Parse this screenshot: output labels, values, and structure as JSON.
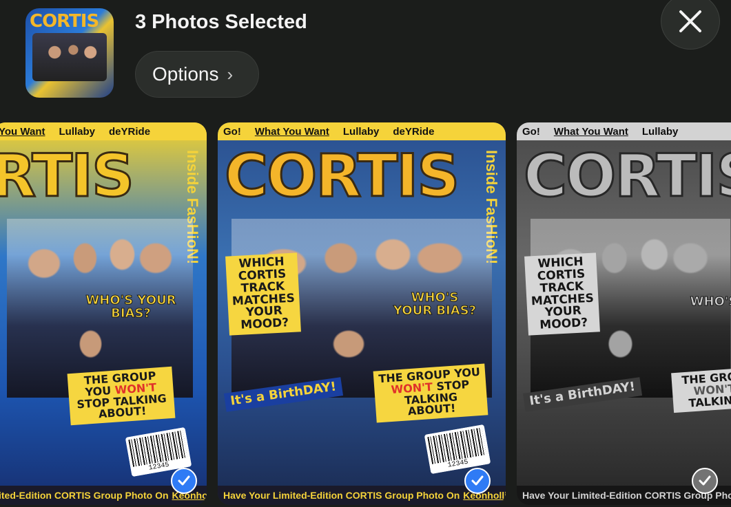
{
  "header": {
    "title": "3 Photos Selected",
    "options_label": "Options",
    "options_chevron": "›",
    "close_icon": "close-icon"
  },
  "thumbnail": {
    "title": "CORTIS"
  },
  "colors": {
    "accent": "#2f7bf5",
    "background": "#1b1d1b",
    "magazine_yellow": "#f5d33a",
    "magazine_orange": "#f4b52a"
  },
  "photos": [
    {
      "topband": [
        "You Want",
        "Lullaby",
        "deYRide"
      ],
      "masthead": "RTIS",
      "side": "Inside FasHioN!",
      "bias": "WHO'S YOUR BIAS?",
      "group_a": "THE GROUP YOU",
      "group_red": "WON'T",
      "group_b": "STOP TALKING ABOUT!",
      "barcode": "12345",
      "bottom_text": "ited-Edition CORTIS Group Photo On",
      "bottom_link": "Keonholliz!",
      "selected": true
    },
    {
      "topband": [
        "Go!",
        "What You Want",
        "Lullaby",
        "deYRide"
      ],
      "masthead": "CORTIS",
      "side": "Inside FasHioN!",
      "which": "WHICH CORTIS TRACK MATCHES YOUR MOOD?",
      "bias": "WHO'S YOUR BIAS?",
      "group_a": "THE GROUP YOU",
      "group_red": "WON'T",
      "group_b": "STOP TALKING ABOUT!",
      "birthday": "It's a BirthDAY!",
      "barcode": "12345",
      "bottom_text": "Have Your Limited-Edition CORTIS Group Photo On",
      "bottom_link": "Keonholliz!",
      "selected": true
    },
    {
      "topband": [
        "Go!",
        "What You Want",
        "Lullaby"
      ],
      "masthead": "CORTIS",
      "which": "WHICH CORTIS TRACK MATCHES YOUR MOOD?",
      "bias": "WHO'S",
      "group_a": "THE GROU",
      "group_red": "WON'T",
      "group_b": "TALKING",
      "birthday": "It's a BirthDAY!",
      "bottom_text": "Have Your Limited-Edition CORTIS Group Phot",
      "selected": true
    }
  ]
}
